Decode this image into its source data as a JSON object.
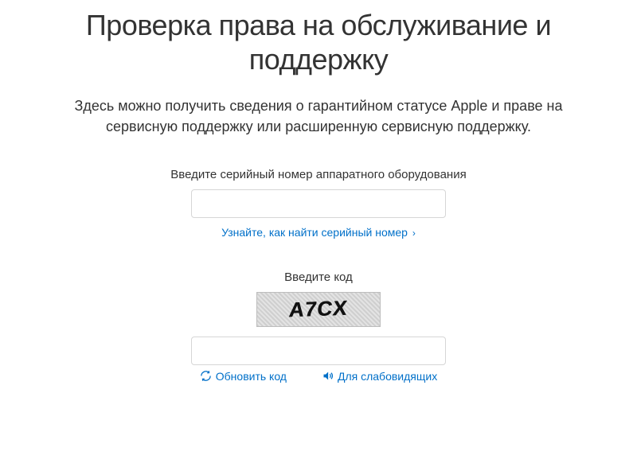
{
  "page": {
    "title": "Проверка права на обслуживание и поддержку",
    "subtitle": "Здесь можно получить сведения о гарантийном статусе Apple и праве на сервисную поддержку или расширенную сервисную поддержку."
  },
  "serial": {
    "label": "Введите серийный номер аппаратного оборудования",
    "value": "",
    "help_link": "Узнайте, как найти серийный номер"
  },
  "captcha": {
    "label": "Введите код",
    "image_text": "A7CX",
    "value": "",
    "refresh_label": "Обновить код",
    "audio_label": "Для слабовидящих"
  },
  "colors": {
    "link": "#0070c9",
    "text": "#333333",
    "border": "#d6d6d6"
  }
}
